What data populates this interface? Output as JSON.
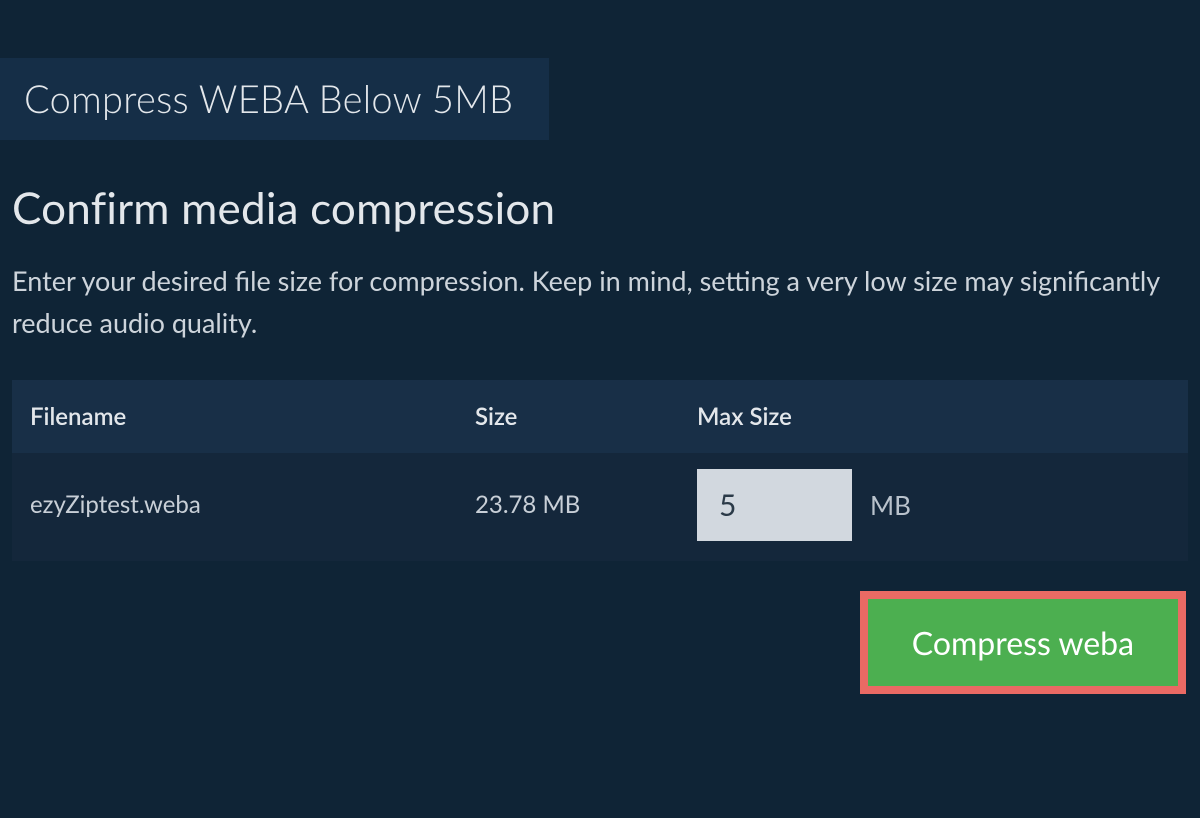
{
  "tab": {
    "label": "Compress WEBA Below 5MB"
  },
  "section": {
    "title": "Confirm media compression",
    "description": "Enter your desired file size for compression. Keep in mind, setting a very low size may significantly reduce audio quality."
  },
  "table": {
    "headers": {
      "filename": "Filename",
      "size": "Size",
      "maxsize": "Max Size"
    },
    "row": {
      "filename": "ezyZiptest.weba",
      "size": "23.78 MB",
      "maxsize_value": "5",
      "maxsize_unit": "MB"
    }
  },
  "button": {
    "compress_label": "Compress weba"
  }
}
